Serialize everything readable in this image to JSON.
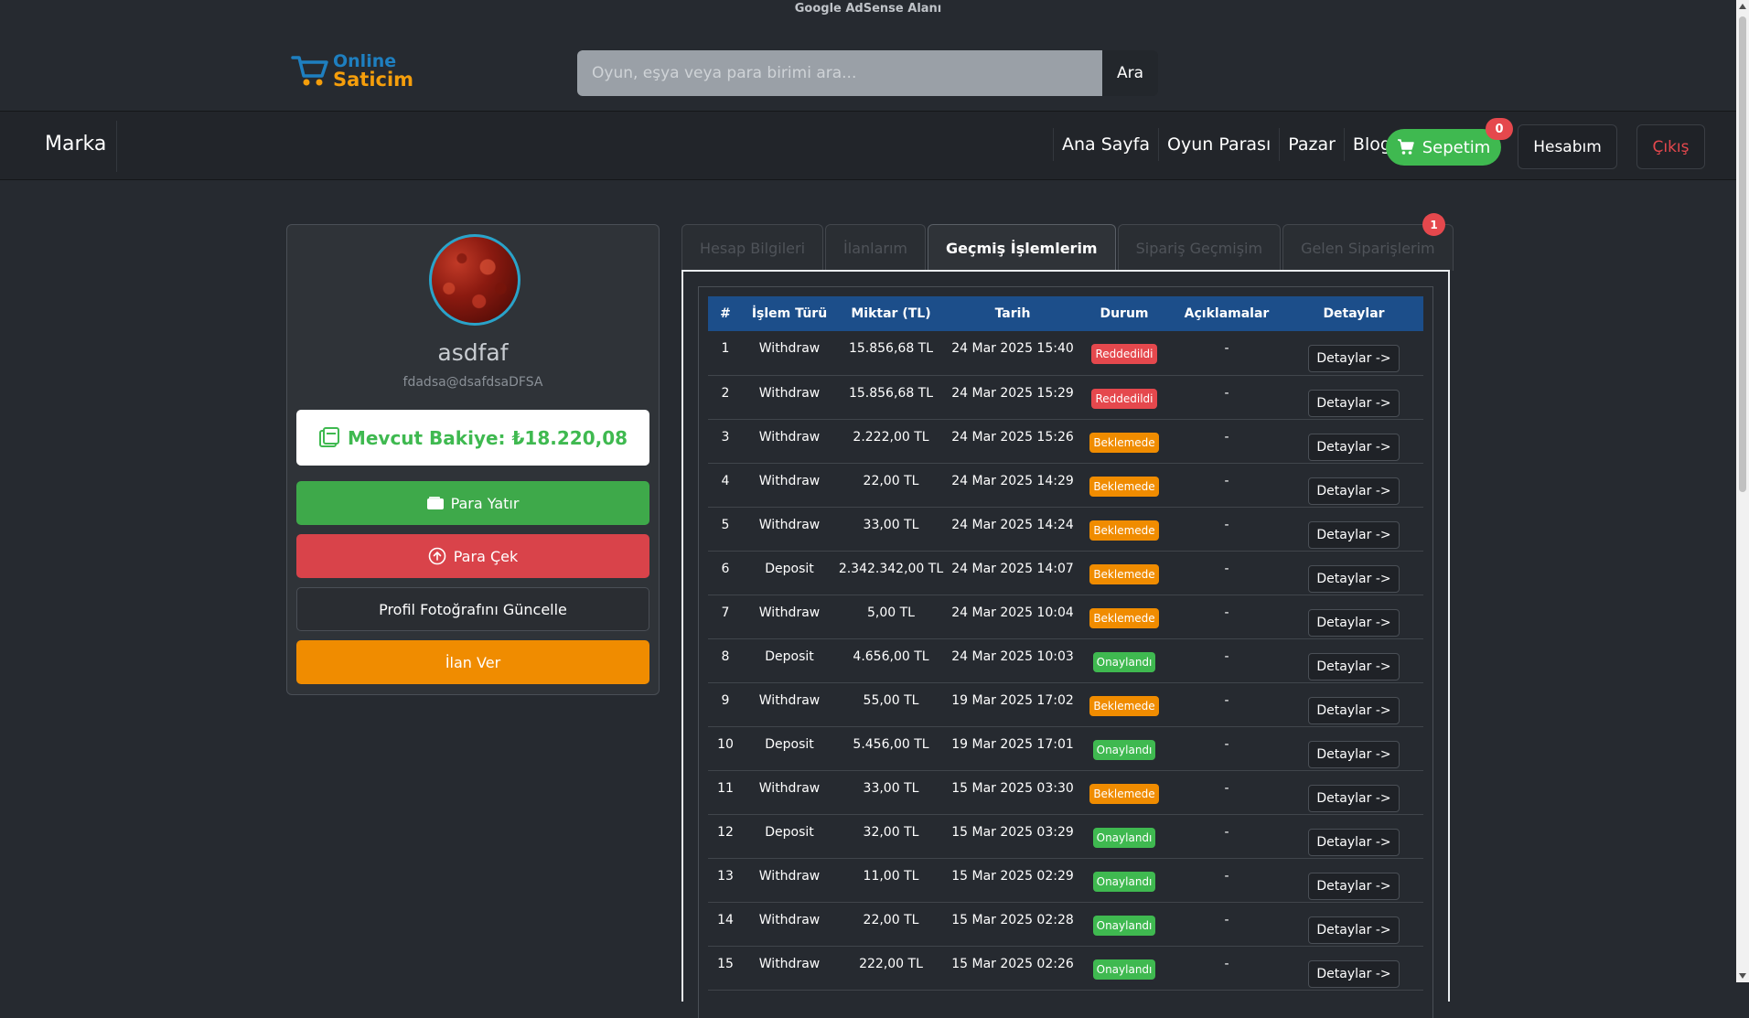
{
  "ad": {
    "label": "Google AdSense Alanı"
  },
  "logo": {
    "line1": "Online",
    "line2": "Saticim"
  },
  "search": {
    "placeholder": "Oyun, eşya veya para birimi ara...",
    "button": "Ara"
  },
  "nav": {
    "brand": "Marka",
    "links": [
      "Ana Sayfa",
      "Oyun Parası",
      "Pazar",
      "Blog"
    ],
    "cart_label": "Sepetim",
    "cart_count": "0",
    "account": "Hesabım",
    "logout": "Çıkış"
  },
  "profile": {
    "username": "asdfaf",
    "email": "fdadsa@dsafdsaDFSA",
    "balance": "Mevcut Bakiye: ₺18.220,08",
    "deposit": "Para Yatır",
    "withdraw": "Para Çek",
    "update_photo": "Profil Fotoğrafını Güncelle",
    "post_listing": "İlan Ver"
  },
  "tabs": {
    "items": [
      "Hesap Bilgileri",
      "İlanlarım",
      "Geçmiş İşlemlerim",
      "Sipariş Geçmişim",
      "Gelen Siparişlerim"
    ],
    "active_index": 2,
    "incoming_badge": "1"
  },
  "table": {
    "headers": [
      "#",
      "İşlem Türü",
      "Miktar (TL)",
      "Tarih",
      "Durum",
      "Açıklamalar",
      "Detaylar"
    ],
    "detail_label": "Detaylar ->",
    "status_colors": {
      "Reddedildi": "#e5484d",
      "Beklemede": "#f08c00",
      "Onaylandı": "#3fb950"
    },
    "rows": [
      {
        "no": "1",
        "type": "Withdraw",
        "amount": "15.856,68 TL",
        "date": "24 Mar 2025 15:40",
        "status": "Reddedildi",
        "desc": "-"
      },
      {
        "no": "2",
        "type": "Withdraw",
        "amount": "15.856,68 TL",
        "date": "24 Mar 2025 15:29",
        "status": "Reddedildi",
        "desc": "-"
      },
      {
        "no": "3",
        "type": "Withdraw",
        "amount": "2.222,00 TL",
        "date": "24 Mar 2025 15:26",
        "status": "Beklemede",
        "desc": "-"
      },
      {
        "no": "4",
        "type": "Withdraw",
        "amount": "22,00 TL",
        "date": "24 Mar 2025 14:29",
        "status": "Beklemede",
        "desc": "-"
      },
      {
        "no": "5",
        "type": "Withdraw",
        "amount": "33,00 TL",
        "date": "24 Mar 2025 14:24",
        "status": "Beklemede",
        "desc": "-"
      },
      {
        "no": "6",
        "type": "Deposit",
        "amount": "2.342.342,00 TL",
        "date": "24 Mar 2025 14:07",
        "status": "Beklemede",
        "desc": "-"
      },
      {
        "no": "7",
        "type": "Withdraw",
        "amount": "5,00 TL",
        "date": "24 Mar 2025 10:04",
        "status": "Beklemede",
        "desc": "-"
      },
      {
        "no": "8",
        "type": "Deposit",
        "amount": "4.656,00 TL",
        "date": "24 Mar 2025 10:03",
        "status": "Onaylandı",
        "desc": "-"
      },
      {
        "no": "9",
        "type": "Withdraw",
        "amount": "55,00 TL",
        "date": "19 Mar 2025 17:02",
        "status": "Beklemede",
        "desc": "-"
      },
      {
        "no": "10",
        "type": "Deposit",
        "amount": "5.456,00 TL",
        "date": "19 Mar 2025 17:01",
        "status": "Onaylandı",
        "desc": "-"
      },
      {
        "no": "11",
        "type": "Withdraw",
        "amount": "33,00 TL",
        "date": "15 Mar 2025 03:30",
        "status": "Beklemede",
        "desc": "-"
      },
      {
        "no": "12",
        "type": "Deposit",
        "amount": "32,00 TL",
        "date": "15 Mar 2025 03:29",
        "status": "Onaylandı",
        "desc": "-"
      },
      {
        "no": "13",
        "type": "Withdraw",
        "amount": "11,00 TL",
        "date": "15 Mar 2025 02:29",
        "status": "Onaylandı",
        "desc": "-"
      },
      {
        "no": "14",
        "type": "Withdraw",
        "amount": "22,00 TL",
        "date": "15 Mar 2025 02:28",
        "status": "Onaylandı",
        "desc": "-"
      },
      {
        "no": "15",
        "type": "Withdraw",
        "amount": "222,00 TL",
        "date": "15 Mar 2025 02:26",
        "status": "Onaylandı",
        "desc": "-"
      }
    ]
  }
}
